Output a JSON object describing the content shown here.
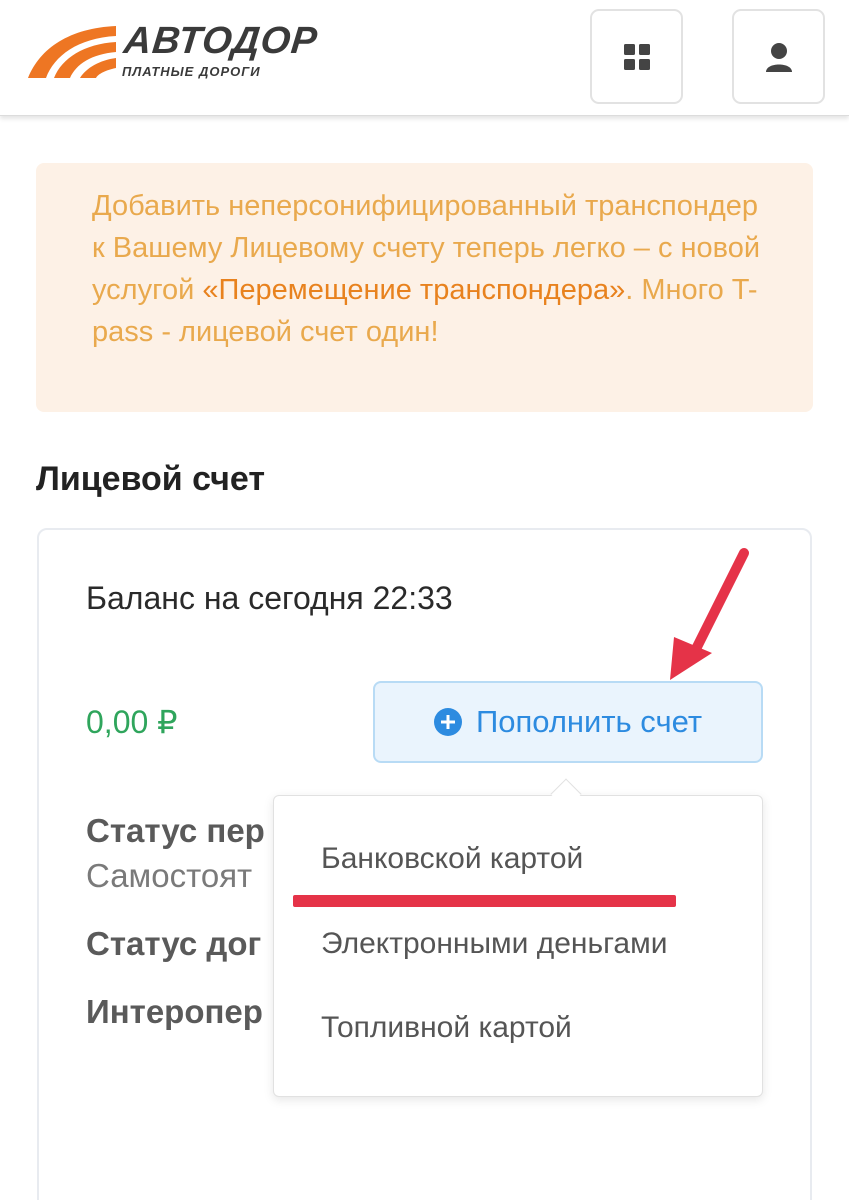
{
  "header": {
    "logo_title": "АВТОДОР",
    "logo_subtitle": "ПЛАТНЫЕ ДОРОГИ",
    "apps_icon": "grid-icon",
    "user_icon": "user-icon",
    "brand_color": "#ee7623"
  },
  "notice": {
    "text_before": "Добавить неперсонифицированный транспондер к Вашему Лицевому счету теперь легко – с новой услугой ",
    "highlight": "«Перемещение транспондера»",
    "text_after": ". Много T-pass - лицевой счет один!"
  },
  "account": {
    "section_title": "Лицевой счет",
    "balance_label": "Баланс на сегодня 22:33",
    "balance_value": "0,00 ₽",
    "topup_label": "Пополнить счет",
    "status_rows": [
      "Статус пер",
      "Самостоят",
      "Статус дог",
      "Интеропер"
    ]
  },
  "dropdown": {
    "items": [
      "Банковской картой",
      "Электронными деньгами",
      "Топливной картой"
    ]
  },
  "colors": {
    "accent_blue": "#2d8be0",
    "balance_green": "#2fa55c",
    "notice_text": "#e9a94d",
    "annotation_red": "#e53348"
  }
}
